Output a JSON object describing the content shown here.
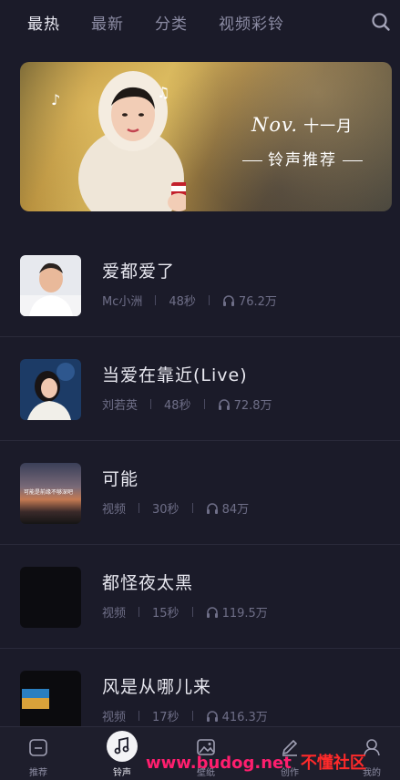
{
  "tabs": [
    {
      "label": "最热",
      "active": true
    },
    {
      "label": "最新",
      "active": false
    },
    {
      "label": "分类",
      "active": false
    },
    {
      "label": "视频彩铃",
      "active": false
    }
  ],
  "search_icon": "search-icon",
  "banner": {
    "month_en": "Nov.",
    "month_cn": "十一月",
    "subtitle": "铃声推荐"
  },
  "songs": [
    {
      "title": "爱都爱了",
      "artist": "Mc小洲",
      "duration": "48秒",
      "plays": "76.2万"
    },
    {
      "title": "当爱在靠近(Live)",
      "artist": "刘若英",
      "duration": "48秒",
      "plays": "72.8万"
    },
    {
      "title": "可能",
      "artist": "视频",
      "duration": "30秒",
      "plays": "84万"
    },
    {
      "title": "都怪夜太黑",
      "artist": "视频",
      "duration": "15秒",
      "plays": "119.5万"
    },
    {
      "title": "风是从哪儿来",
      "artist": "视频",
      "duration": "17秒",
      "plays": "416.3万"
    }
  ],
  "thumb_caption": "可能是前缘不够深吧",
  "nav": [
    {
      "label": "推荐",
      "icon": "home-icon"
    },
    {
      "label": "铃声",
      "icon": "music-note-icon",
      "active": true
    },
    {
      "label": "壁纸",
      "icon": "image-icon"
    },
    {
      "label": "创作",
      "icon": "pencil-icon"
    },
    {
      "label": "我的",
      "icon": "user-icon"
    }
  ],
  "watermark": {
    "site": "www.budog.net",
    "name": "不懂社区"
  },
  "colors": {
    "background": "#1b1b29",
    "accent_watermark": "#ff1e6e"
  }
}
